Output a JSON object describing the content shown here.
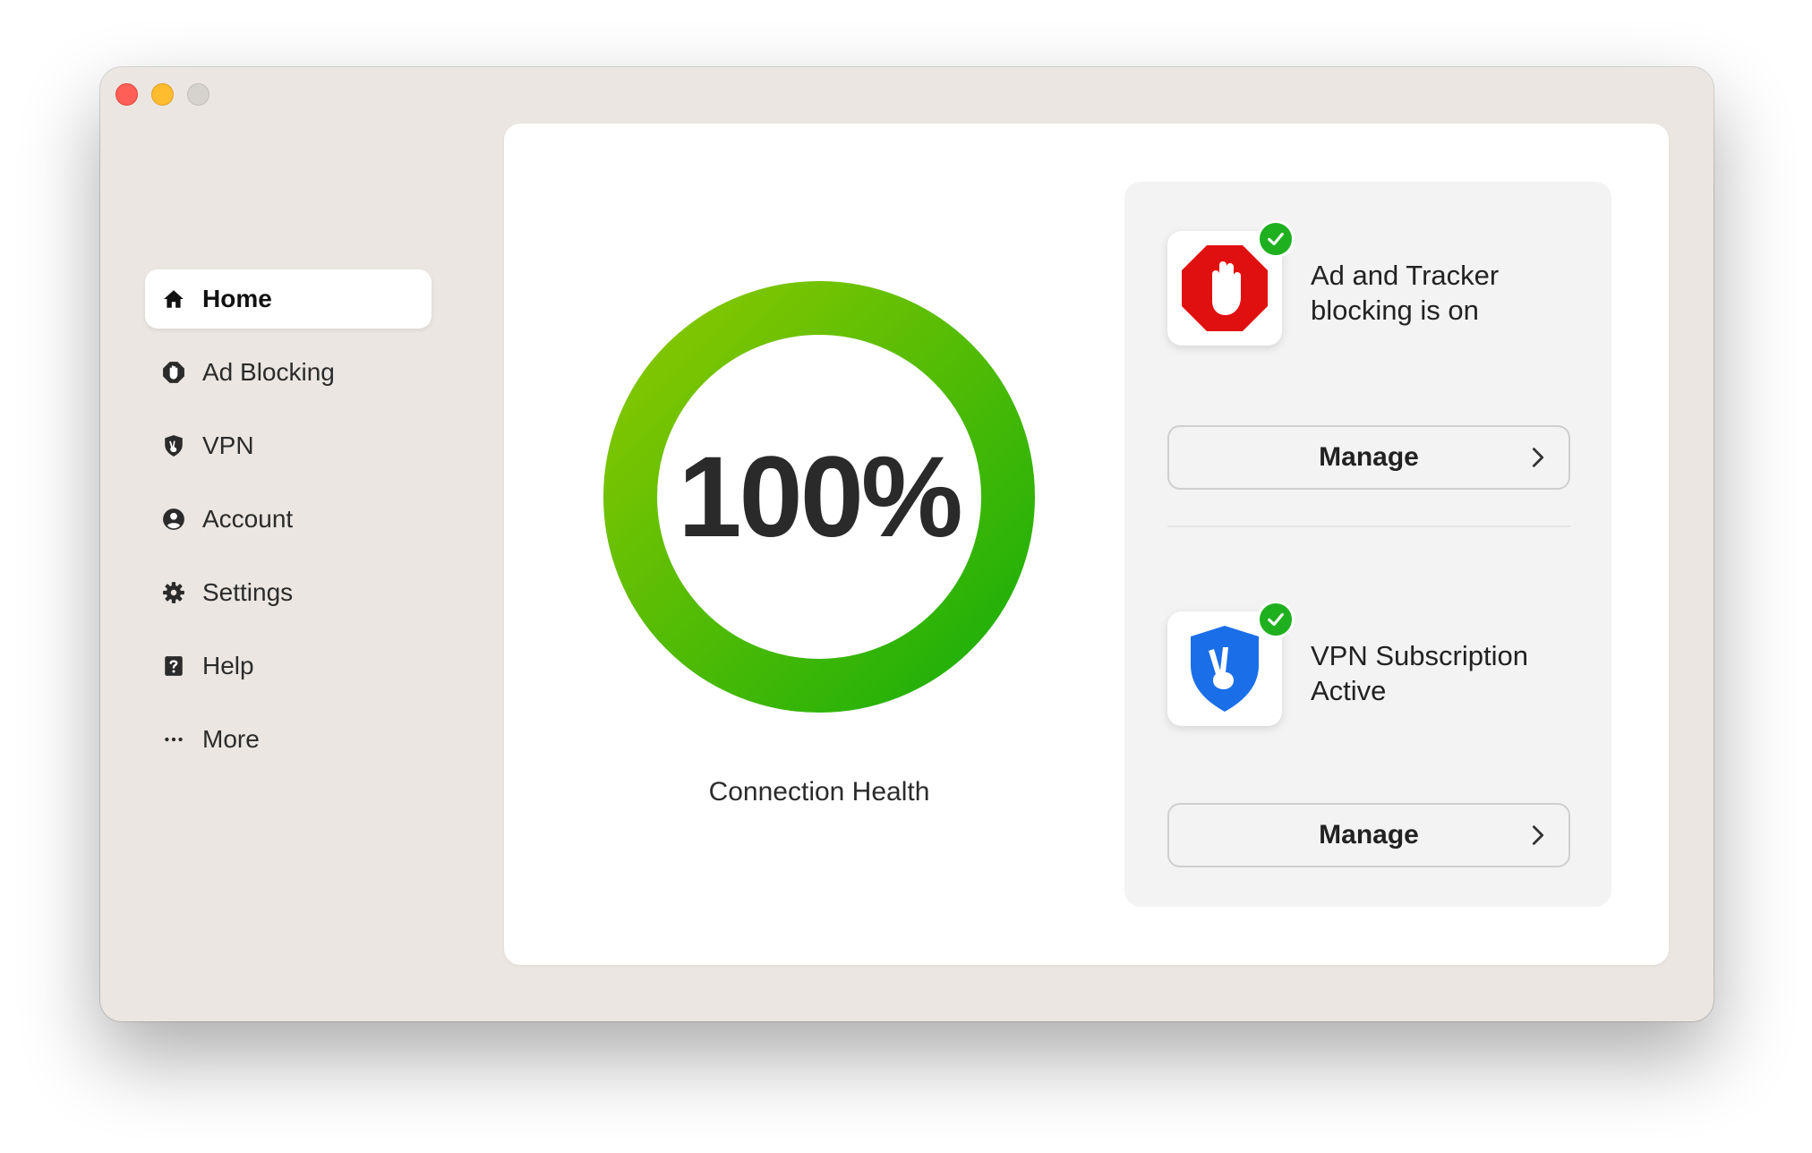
{
  "window": {
    "controls": [
      "close",
      "minimize",
      "maximize"
    ]
  },
  "sidebar": {
    "items": [
      {
        "label": "Home",
        "icon": "home-icon",
        "active": true
      },
      {
        "label": "Ad Blocking",
        "icon": "hand-stop-icon",
        "active": false
      },
      {
        "label": "VPN",
        "icon": "shield-peace-icon",
        "active": false
      },
      {
        "label": "Account",
        "icon": "user-circle-icon",
        "active": false
      },
      {
        "label": "Settings",
        "icon": "gear-icon",
        "active": false
      },
      {
        "label": "Help",
        "icon": "question-icon",
        "active": false
      },
      {
        "label": "More",
        "icon": "ellipsis-icon",
        "active": false
      }
    ]
  },
  "health": {
    "percent_text": "100%",
    "fill_fraction": 1.0,
    "label": "Connection Health",
    "gradient": [
      "#8ac800",
      "#1aaf0a"
    ]
  },
  "features": [
    {
      "title": "Ad and Tracker blocking is on",
      "icon": "stop-hand-icon",
      "status": "enabled",
      "button": "Manage"
    },
    {
      "title": "VPN Subscription Active",
      "icon": "vpn-shield-icon",
      "status": "enabled",
      "button": "Manage"
    }
  ],
  "colors": {
    "window_bg": "#ebe6e1",
    "card_bg": "#ffffff",
    "panel_bg": "#f3f3f3",
    "success": "#1fb01f",
    "adblock_red": "#e01010",
    "vpn_blue": "#1a6fe8"
  }
}
